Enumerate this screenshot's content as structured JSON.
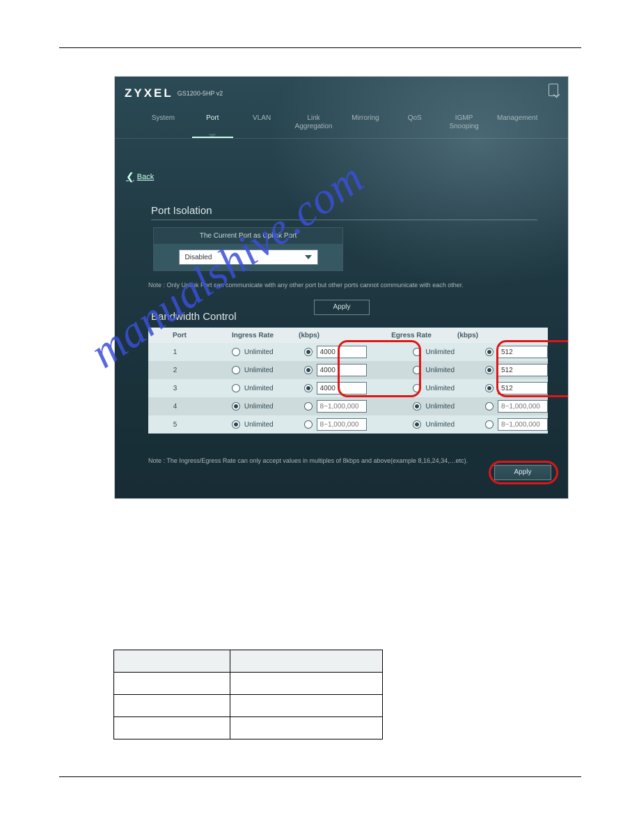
{
  "header": {
    "brand": "ZYXEL",
    "model": "GS1200-5HP v2"
  },
  "nav": {
    "items": [
      {
        "label": "System"
      },
      {
        "label": "Port"
      },
      {
        "label": "VLAN"
      },
      {
        "label": "Link\nAggregation"
      },
      {
        "label": "Mirroring"
      },
      {
        "label": "QoS"
      },
      {
        "label": "IGMP\nSnooping"
      },
      {
        "label": "Management"
      }
    ],
    "active_index": 1
  },
  "back": "Back",
  "sections": {
    "isolation": {
      "title": "Port Isolation",
      "panel_header": "The Current Port as Uplink Port",
      "dropdown_value": "Disabled",
      "note": "Note : Only Uplink Port can communicate with any other port but other ports cannot communicate with each other.",
      "apply": "Apply"
    },
    "bandwidth": {
      "title": "Bandwidth Control",
      "headers": {
        "port": "Port",
        "ingress": "Ingress Rate",
        "egress": "Egress Rate",
        "unit": "(kbps)"
      },
      "unlimited_label": "Unlimited",
      "placeholder": "8~1,000,000",
      "rows": [
        {
          "port": "1",
          "ingress_unlimited": false,
          "ingress_value": "4000",
          "egress_unlimited": false,
          "egress_value": "512"
        },
        {
          "port": "2",
          "ingress_unlimited": false,
          "ingress_value": "4000",
          "egress_unlimited": false,
          "egress_value": "512"
        },
        {
          "port": "3",
          "ingress_unlimited": false,
          "ingress_value": "4000",
          "egress_unlimited": false,
          "egress_value": "512"
        },
        {
          "port": "4",
          "ingress_unlimited": true,
          "ingress_value": "",
          "egress_unlimited": true,
          "egress_value": ""
        },
        {
          "port": "5",
          "ingress_unlimited": true,
          "ingress_value": "",
          "egress_unlimited": true,
          "egress_value": ""
        }
      ],
      "note": "Note : The Ingress/Egress Rate can only accept values in multiples of 8kbps and above(example 8,16,24,34,…etc).",
      "apply": "Apply"
    }
  },
  "watermark": "manualshive.com",
  "bottom_table": {
    "header": [
      "",
      ""
    ],
    "rows": [
      [
        "",
        ""
      ],
      [
        "",
        ""
      ],
      [
        "",
        ""
      ]
    ]
  }
}
